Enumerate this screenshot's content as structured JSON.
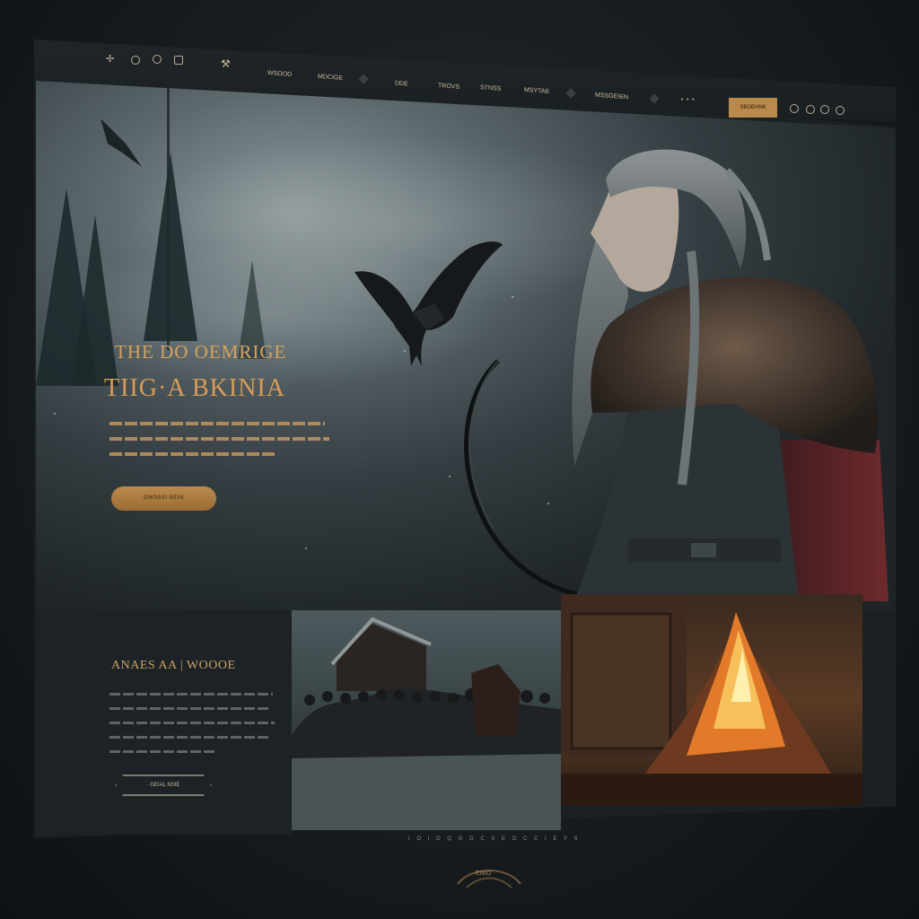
{
  "nav": {
    "logo_icon": "axe-icon",
    "left_icons": [
      "compass-icon",
      "ring-icon",
      "ring-icon"
    ],
    "links": [
      "WSOOD",
      "MDCIGE",
      "DDE",
      "TROVS",
      "STNSS",
      "MSYTAE",
      "MSSGEIEN"
    ],
    "cta_label": "SBOEHNK",
    "right_icons": [
      "search-icon",
      "user-icon",
      "lock-icon"
    ]
  },
  "hero": {
    "title_line1": "THE DO OEMRIGE",
    "title_line2": "TIIG·A BKINIA",
    "button_label": "DWSASI BEIN"
  },
  "section": {
    "title": "ANAES AA | WOOOE",
    "button_label": "· GEIAL NSIE"
  },
  "footer": {
    "pager": "I O I O Q G G C S E O C C I E Y S",
    "emblem_text": "ENIO"
  },
  "colors": {
    "accent": "#c99a5a",
    "background": "#171b1e",
    "panel": "#1c2226"
  }
}
